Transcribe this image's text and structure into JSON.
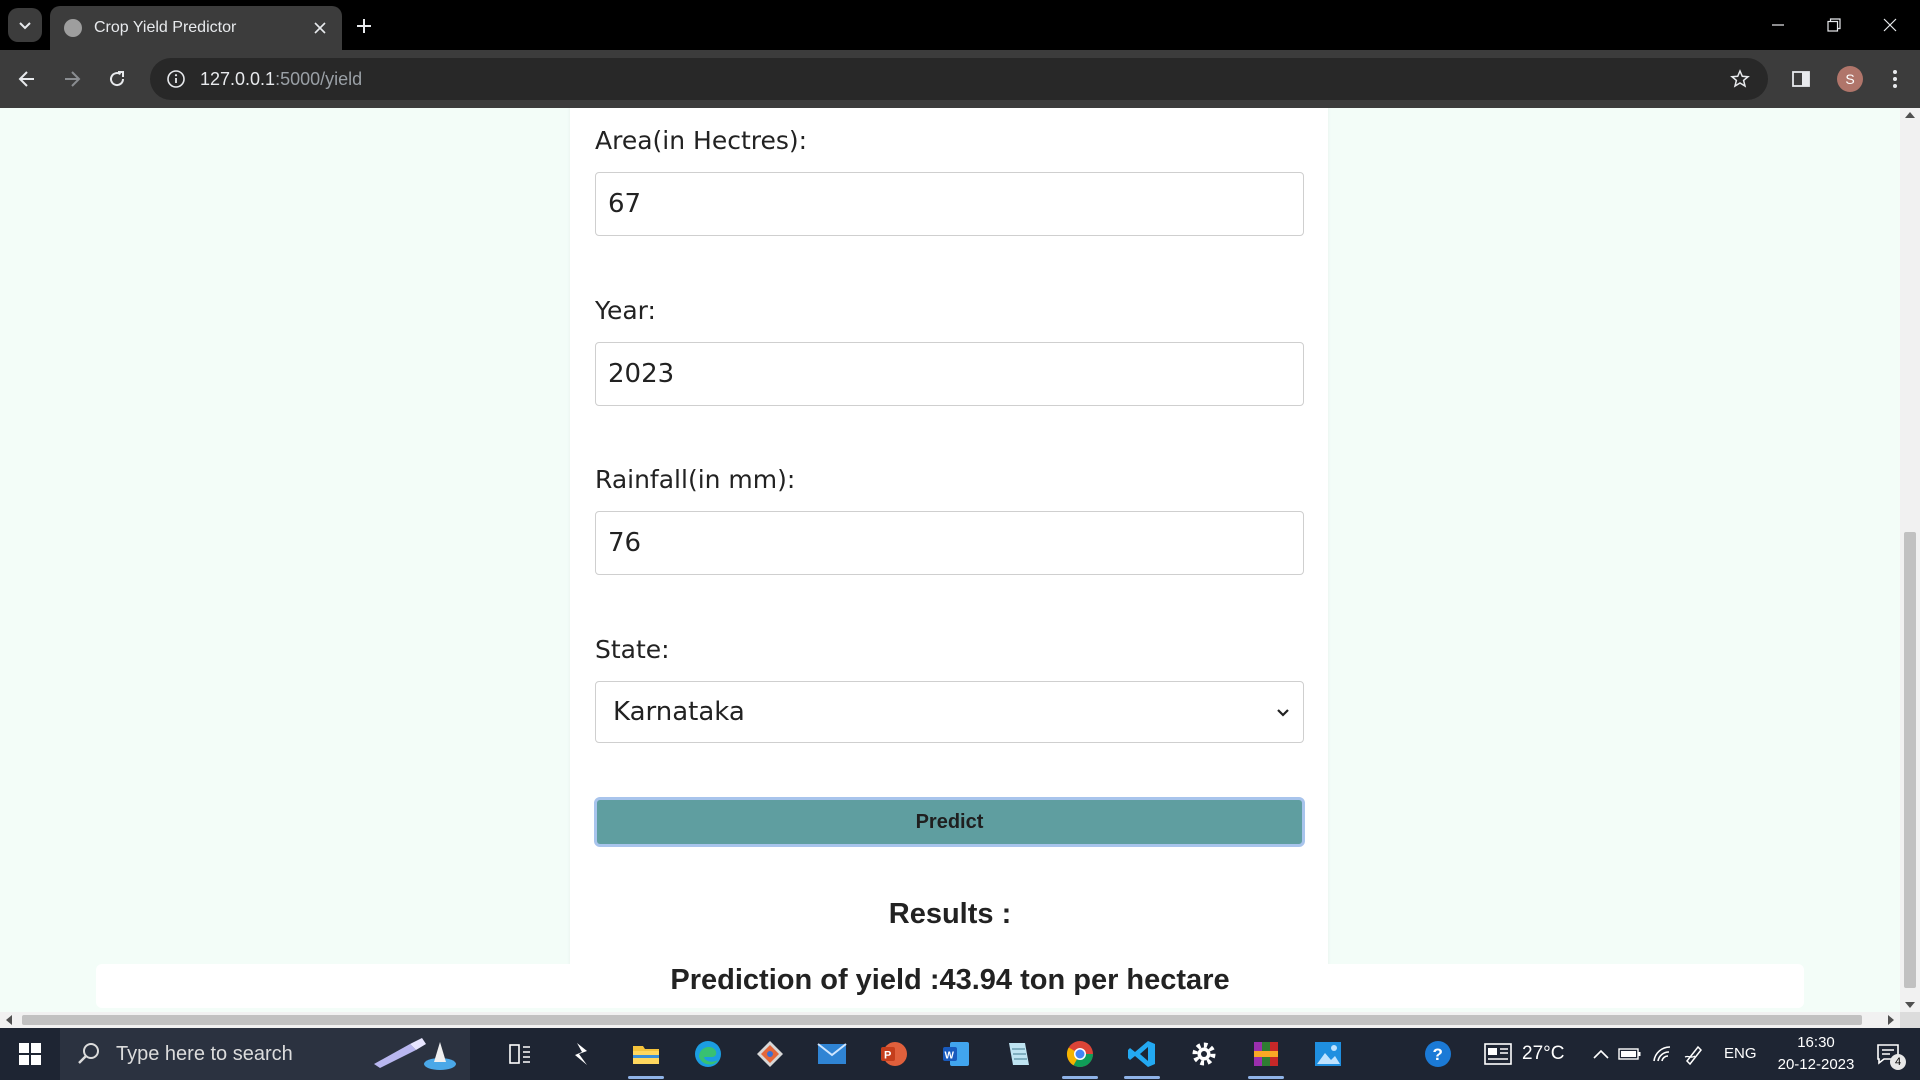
{
  "browser": {
    "tab_title": "Crop Yield Predictor",
    "url_host": "127.0.0.1",
    "url_path": ":5000/yield",
    "profile_initial": "S"
  },
  "form": {
    "area_label": "Area(in Hectres):",
    "area_value": "67",
    "year_label": "Year:",
    "year_value": "2023",
    "rainfall_label": "Rainfall(in mm):",
    "rainfall_value": "76",
    "state_label": "State:",
    "state_value": "Karnataka",
    "predict_label": "Predict"
  },
  "results": {
    "title": "Results :",
    "text": "Prediction of yield :43.94 ton per hectare"
  },
  "colors": {
    "page_bg": "#f3fdf8",
    "button": "#5f9ea0",
    "button_border": "#a8c4ec"
  },
  "taskbar": {
    "search_placeholder": "Type here to search",
    "weather": "27°C",
    "language": "ENG",
    "time": "16:30",
    "date": "20-12-2023",
    "notification_count": "4",
    "pinned_icons": [
      "task-view-icon",
      "vs-icon",
      "file-explorer-icon",
      "edge-icon",
      "git-icon",
      "mail-icon",
      "powerpoint-icon",
      "word-icon",
      "notepad-icon",
      "chrome-icon",
      "vscode-icon",
      "settings-icon",
      "winrar-icon",
      "photos-icon"
    ]
  }
}
